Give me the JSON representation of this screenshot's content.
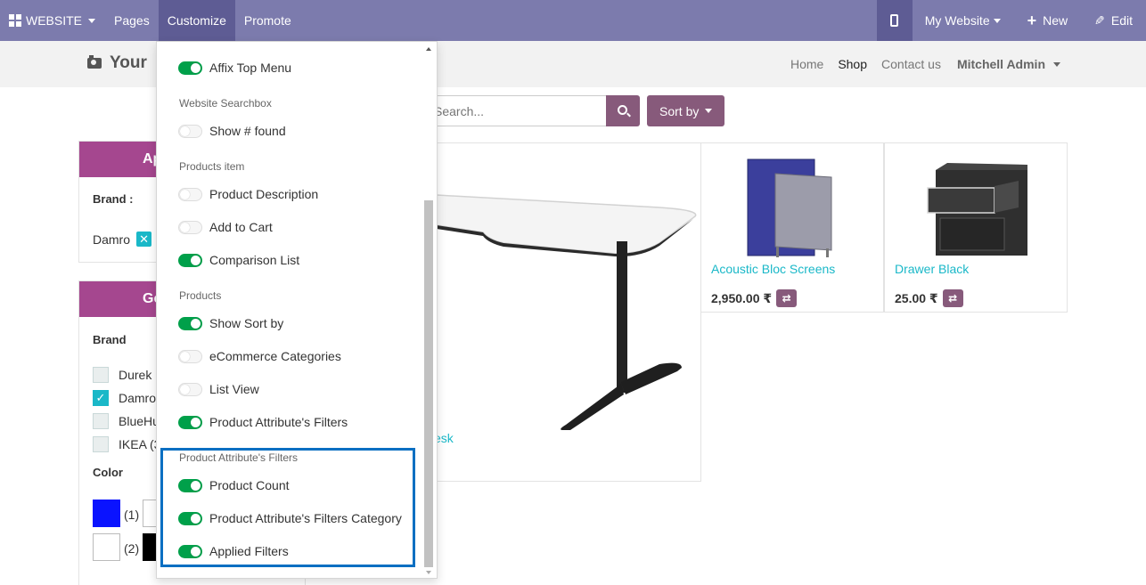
{
  "topbar": {
    "website_label": "WEBSITE",
    "pages_label": "Pages",
    "customize_label": "Customize",
    "promote_label": "Promote",
    "my_website_label": "My Website",
    "new_label": "New",
    "edit_label": "Edit",
    "bg_color": "#7c7bad",
    "active_color": "#5e5c94"
  },
  "site": {
    "logo_text": "Your",
    "nav": [
      "Home",
      "Shop",
      "Contact us"
    ],
    "user": "Mitchell Admin"
  },
  "search": {
    "placeholder": "Search...",
    "sort_label": "Sort by"
  },
  "sidebar": {
    "applied_title": "Ap",
    "brand_label": "Brand :",
    "applied_tag": "Damro",
    "general_title": "Gen",
    "brand_heading": "Brand",
    "brands": [
      {
        "label": "Durek (",
        "checked": false
      },
      {
        "label": "Damro",
        "checked": true
      },
      {
        "label": "BlueHu",
        "checked": false
      },
      {
        "label": "IKEA (3",
        "checked": false
      }
    ],
    "color_heading": "Color",
    "colors": [
      {
        "color": "#0a13ff",
        "count": "(1)"
      },
      {
        "color": "#ffffff",
        "count": ""
      },
      {
        "color": "#ffffff",
        "count": "(2)"
      },
      {
        "color": "#000000",
        "count": ""
      }
    ]
  },
  "products": [
    {
      "name": "esk",
      "price": ""
    },
    {
      "name": "Acoustic Bloc Screens",
      "price": "2,950.00 ₹"
    },
    {
      "name": "Drawer Black",
      "price": "25.00 ₹"
    }
  ],
  "customize_menu": {
    "items": [
      {
        "type": "toggle",
        "label": "Affix Top Menu",
        "on": true
      },
      {
        "type": "header",
        "label": "Website Searchbox"
      },
      {
        "type": "toggle",
        "label": "Show # found",
        "on": false
      },
      {
        "type": "header",
        "label": "Products item"
      },
      {
        "type": "toggle",
        "label": "Product Description",
        "on": false
      },
      {
        "type": "toggle",
        "label": "Add to Cart",
        "on": false
      },
      {
        "type": "toggle",
        "label": "Comparison List",
        "on": true
      },
      {
        "type": "header",
        "label": "Products"
      },
      {
        "type": "toggle",
        "label": "Show Sort by",
        "on": true
      },
      {
        "type": "toggle",
        "label": "eCommerce Categories",
        "on": false
      },
      {
        "type": "toggle",
        "label": "List View",
        "on": false
      },
      {
        "type": "toggle",
        "label": "Product Attribute's Filters",
        "on": true
      },
      {
        "type": "header",
        "label": "Product Attribute's Filters"
      },
      {
        "type": "toggle",
        "label": "Product Count",
        "on": true
      },
      {
        "type": "toggle",
        "label": "Product Attribute's Filters Category",
        "on": true
      },
      {
        "type": "toggle",
        "label": "Applied Filters",
        "on": true
      }
    ],
    "toggle_on_color": "#00a04a",
    "highlight_color": "#0a6fc2"
  }
}
